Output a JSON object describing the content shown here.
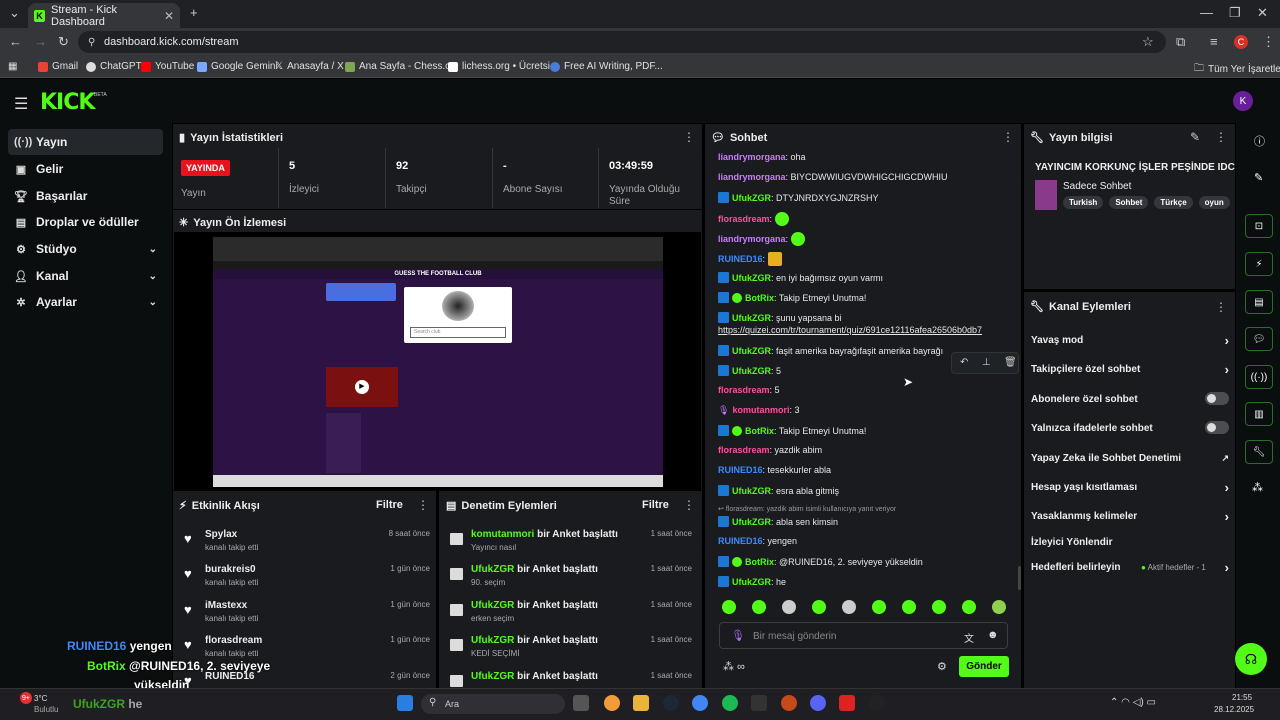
{
  "browser": {
    "tab_title": "Stream - Kick Dashboard",
    "url": "dashboard.kick.com/stream",
    "profile_initial": "C",
    "bookmarks": [
      "Gmail",
      "ChatGPT",
      "YouTube",
      "Google Gemini",
      "Anasayfa / X",
      "Ana Sayfa - Chess.c...",
      "lichess.org • Ücretsi...",
      "Free AI Writing, PDF..."
    ],
    "all_bookmarks": "Tüm Yer İşaretleri"
  },
  "header": {
    "logo": "KICK",
    "beta": "BETA",
    "avatar_initial": "K"
  },
  "sidebar": {
    "items": [
      {
        "label": "Yayın",
        "icon": "broadcast-icon"
      },
      {
        "label": "Gelir",
        "icon": "wallet-icon"
      },
      {
        "label": "Başarılar",
        "icon": "trophy-icon"
      },
      {
        "label": "Droplar ve ödüller",
        "icon": "gift-icon"
      },
      {
        "label": "Stüdyo",
        "icon": "gear-icon"
      },
      {
        "label": "Kanal",
        "icon": "person-icon"
      },
      {
        "label": "Ayarlar",
        "icon": "cog-icon"
      }
    ]
  },
  "stats": {
    "title": "Yayın İstatistikleri",
    "live_badge": "YAYINDA",
    "status_label": "Yayın",
    "viewers_value": "5",
    "viewers_label": "İzleyici",
    "followers_value": "92",
    "followers_label": "Takipçi",
    "subs_value": "-",
    "subs_label": "Abone Sayısı",
    "uptime_value": "03:49:59",
    "uptime_label": "Yayında Olduğu Süre"
  },
  "preview": {
    "title": "Yayın Ön İzlemesi",
    "game_title": "GUESS THE FOOTBALL CLUB",
    "search_placeholder": "Search club"
  },
  "activity": {
    "title": "Etkinlik Akışı",
    "filter": "Filtre",
    "rows": [
      {
        "name": "Spylax",
        "sub": "kanalı takip etti",
        "time": "8 saat önce"
      },
      {
        "name": "burakreis0",
        "sub": "kanalı takip etti",
        "time": "1 gün önce"
      },
      {
        "name": "iMastexx",
        "sub": "kanalı takip etti",
        "time": "1 gün önce"
      },
      {
        "name": "florasdream",
        "sub": "kanalı takip etti",
        "time": "1 gün önce"
      },
      {
        "name": "RUINED16",
        "sub": "",
        "time": "2 gün önce"
      }
    ]
  },
  "moderation": {
    "title": "Denetim Eylemleri",
    "filter": "Filtre",
    "rows": [
      {
        "user": "komutanmori",
        "action": " bir Anket başlattı",
        "sub": "Yayıncı nasıl",
        "time": "1 saat önce"
      },
      {
        "user": "UfukZGR",
        "action": " bir Anket başlattı",
        "sub": "90. seçim",
        "time": "1 saat önce"
      },
      {
        "user": "UfukZGR",
        "action": " bir Anket başlattı",
        "sub": "erken seçim",
        "time": "1 saat önce"
      },
      {
        "user": "UfukZGR",
        "action": " bir Anket başlattı",
        "sub": "KEDİ SEÇİMİ",
        "time": "1 saat önce"
      },
      {
        "user": "UfukZGR",
        "action": " bir Anket başlattı",
        "sub": "",
        "time": "1 saat önce"
      }
    ]
  },
  "chat": {
    "title": "Sohbet",
    "input_placeholder": "Bir mesaj gönderin",
    "send": "Gönder",
    "reply_note": "florasdream: yazdik abim isimli kullanıcıya yanıt veriyor",
    "link": "https://quizei.com/tr/tournament/quiz/691ce12116afea26506b0db7",
    "messages": [
      {
        "user": "liandrymorgana",
        "color": "#c77dff",
        "text": "oha"
      },
      {
        "user": "liandrymorgana",
        "color": "#c77dff",
        "text": "BIYCDWWIUGVDWHIGCHIGCDWHIU"
      },
      {
        "user": "UfukZGR",
        "color": "#53fc18",
        "text": "DTYJNRDXYGJNZRSHY"
      },
      {
        "user": "florasdream",
        "color": "#ff4fa0",
        "text": ""
      },
      {
        "user": "liandrymorgana",
        "color": "#c77dff",
        "text": ""
      },
      {
        "user": "RUINED16",
        "color": "#3b8cff",
        "text": ""
      },
      {
        "user": "UfukZGR",
        "color": "#53fc18",
        "text": "en iyi bağımsız oyun varmı"
      },
      {
        "user": "BotRix",
        "color": "#53fc18",
        "text": "Takip Etmeyi Unutma!"
      },
      {
        "user": "UfukZGR",
        "color": "#53fc18",
        "text": "şunu yapsana bi"
      },
      {
        "user": "UfukZGR",
        "color": "#53fc18",
        "text": "faşit amerika bayrağıfaşit amerika bayrağı"
      },
      {
        "user": "UfukZGR",
        "color": "#53fc18",
        "text": "5"
      },
      {
        "user": "florasdream",
        "color": "#ff4fa0",
        "text": "5"
      },
      {
        "user": "komutanmori",
        "color": "#ff4fa0",
        "text": "3"
      },
      {
        "user": "BotRix",
        "color": "#53fc18",
        "text": "Takip Etmeyi Unutma!"
      },
      {
        "user": "florasdream",
        "color": "#ff4fa0",
        "text": "yazdik abim"
      },
      {
        "user": "RUINED16",
        "color": "#3b8cff",
        "text": "tesekkurler abla"
      },
      {
        "user": "UfukZGR",
        "color": "#53fc18",
        "text": "esra abla gitmiş"
      },
      {
        "user": "UfukZGR",
        "color": "#53fc18",
        "text": "abla sen kimsin"
      },
      {
        "user": "RUINED16",
        "color": "#3b8cff",
        "text": "yengen"
      },
      {
        "user": "BotRix",
        "color": "#53fc18",
        "text": "@RUINED16, 2. seviyeye yükseldin"
      },
      {
        "user": "UfukZGR",
        "color": "#53fc18",
        "text": "he"
      }
    ]
  },
  "stream_info": {
    "title": "Yayın bilgisi",
    "stream_title": "YAYINCIM KORKUNÇ İŞLER PEŞİNDE IDC",
    "category": "Sadece Sohbet",
    "tags": [
      "Turkish",
      "Sohbet",
      "Türkçe",
      "oyun"
    ]
  },
  "channel_actions": {
    "title": "Kanal Eylemleri",
    "slow_mode": "Yavaş mod",
    "followers_chat": "Takipçilere özel sohbet",
    "subs_chat": "Abonelere özel sohbet",
    "emote_chat": "Yalnızca ifadelerle sohbet",
    "ai_mod": "Yapay Zeka ile Sohbet Denetimi",
    "age": "Hesap yaşı kısıtlaması",
    "banned_words": "Yasaklanmış kelimeler",
    "redirect": "İzleyici Yönlendir",
    "goals": "Hedefleri belirleyin",
    "goals_status": "Aktif hedefler - 1"
  },
  "overlay": {
    "l1_user": "RUINED16",
    "l1_text": "yengen",
    "l2_user": "BotRix",
    "l2_text": "@RUINED16, 2. seviyeye",
    "l3_text": "yükseldin",
    "l4_user": "UfukZGR",
    "l4_text": "he"
  },
  "taskbar": {
    "weather_temp": "3°C",
    "weather_desc": "Bulutlu",
    "badge": "9+",
    "search": "Ara",
    "time": "21:55",
    "date": "28.12.2025"
  }
}
